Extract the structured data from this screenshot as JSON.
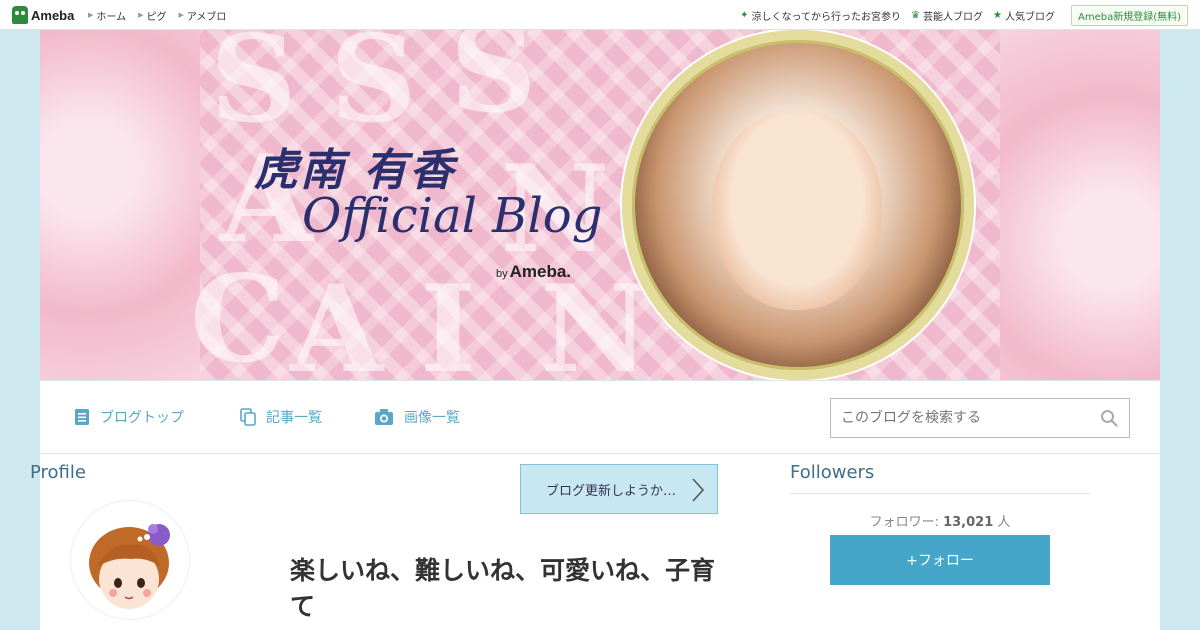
{
  "topbar": {
    "logo_text": "Ameba",
    "nav": [
      {
        "label": "ホーム"
      },
      {
        "label": "ピグ"
      },
      {
        "label": "アメブロ"
      }
    ],
    "right_links": [
      {
        "label": "涼しくなってから行ったお宮参り",
        "icon": "sparkle-icon"
      },
      {
        "label": "芸能人ブログ",
        "icon": "crown-icon"
      },
      {
        "label": "人気ブログ",
        "icon": "star-icon"
      }
    ],
    "signup_label": "Ameba新規登録(無料)"
  },
  "banner": {
    "name_jp": "虎南 有香",
    "subtitle": "Official Blog",
    "by_prefix": "by",
    "by_brand": "Ameba."
  },
  "nav": {
    "items": [
      {
        "label": "ブログトップ",
        "icon": "document-icon"
      },
      {
        "label": "記事一覧",
        "icon": "copy-icon"
      },
      {
        "label": "画像一覧",
        "icon": "camera-icon"
      }
    ],
    "search_placeholder": "このブログを検索する"
  },
  "profile": {
    "heading": "Profile",
    "update_button": "ブログ更新しようか…"
  },
  "entry": {
    "title": "楽しいね、難しいね、可愛いね、子育て"
  },
  "followers": {
    "heading": "Followers",
    "count_label": "フォロワー: ",
    "count_value": "13,021",
    "count_unit": " 人",
    "follow_button": "+フォロー"
  },
  "colors": {
    "accent": "#45a6c9",
    "nav_text": "#5aa7c8",
    "heading": "#3f6e8a",
    "ameba_green": "#2d8c3c"
  }
}
